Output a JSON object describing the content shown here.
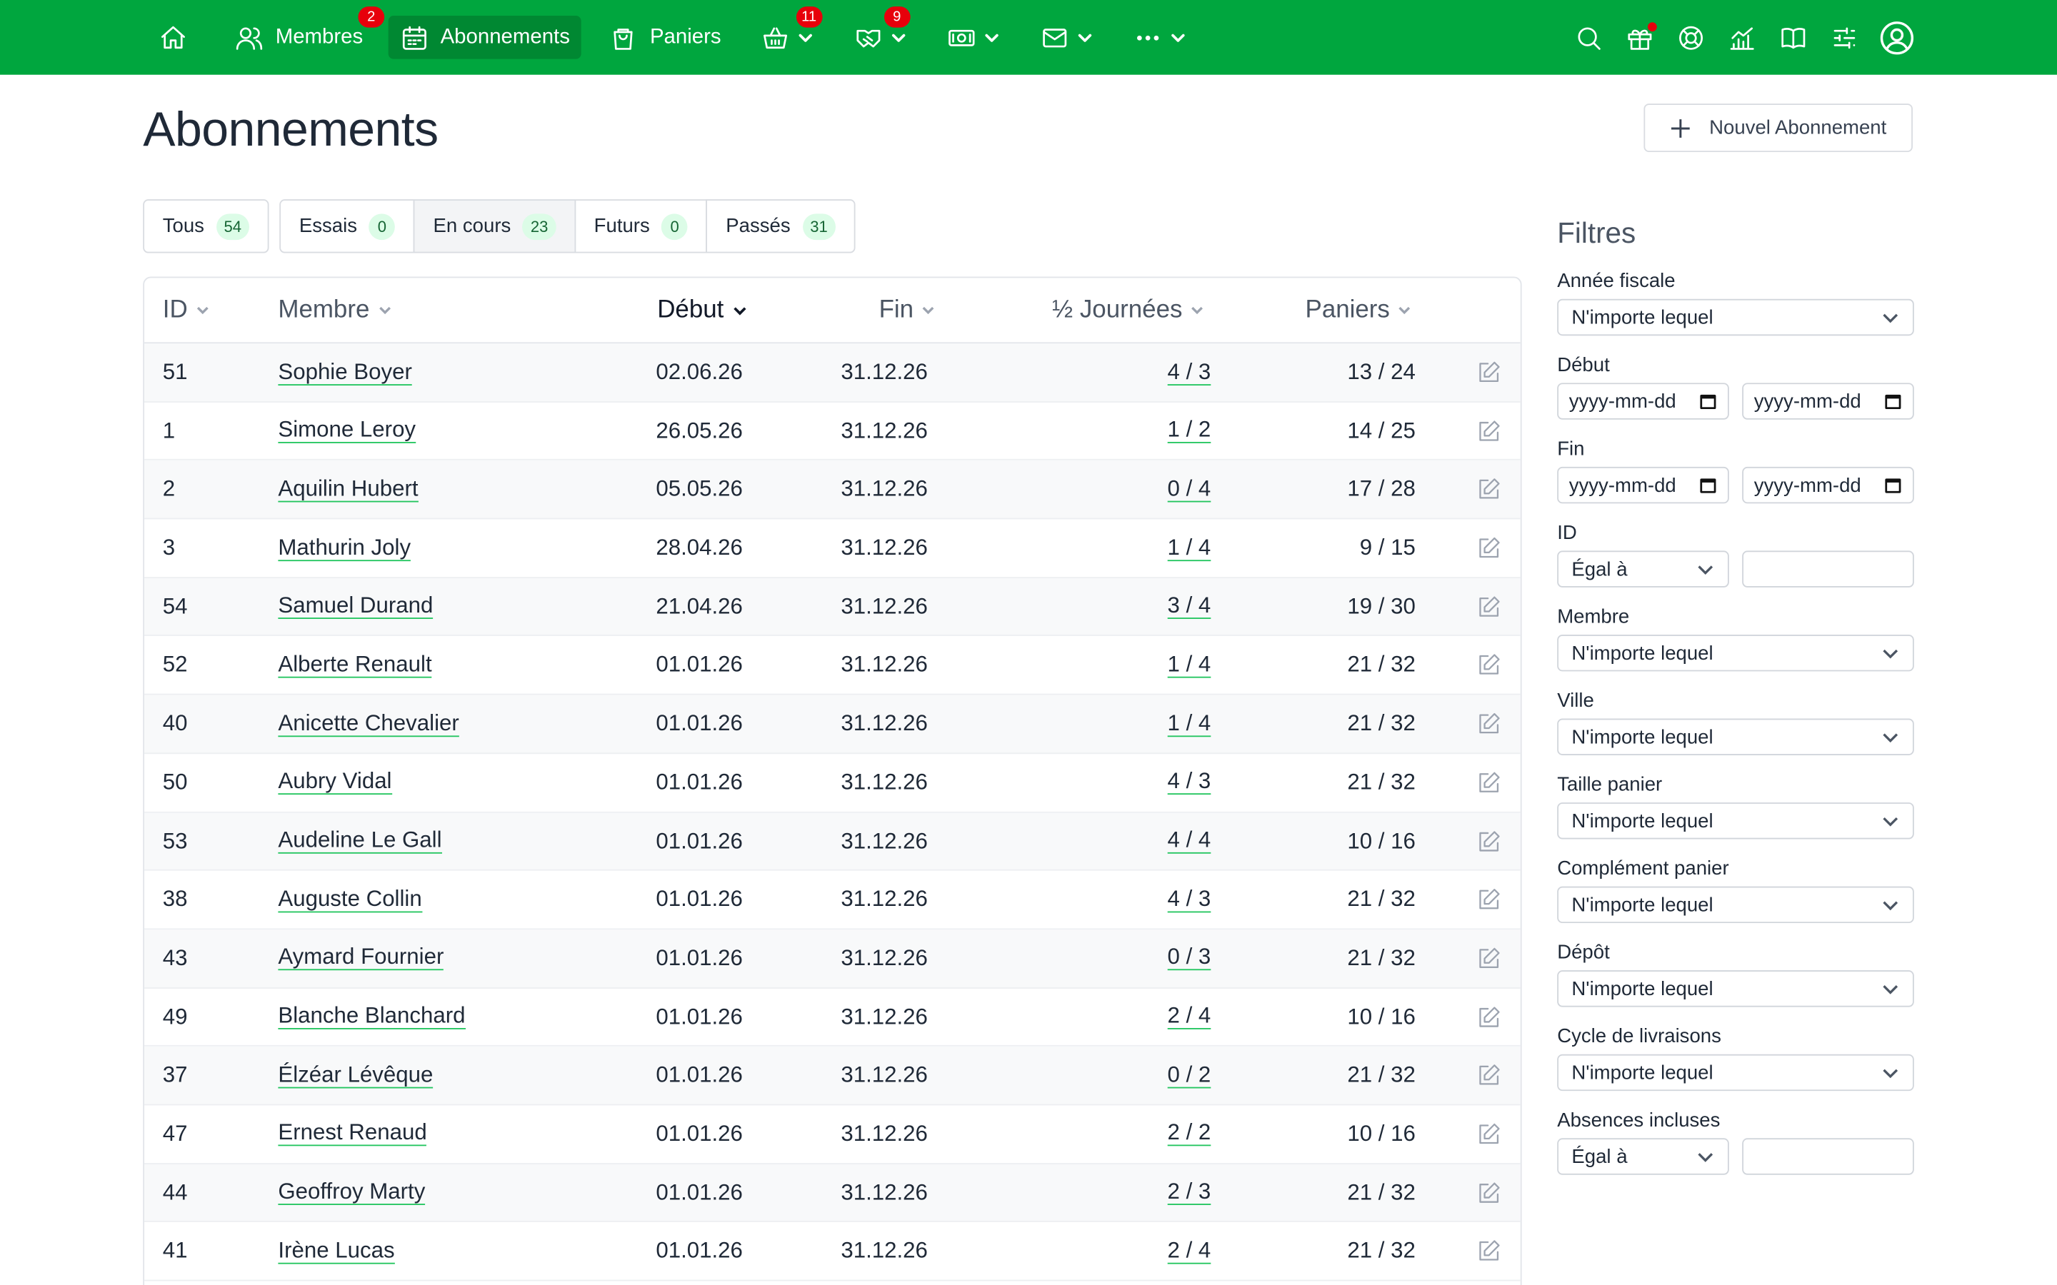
{
  "nav": {
    "items": [
      {
        "label": "",
        "icon": "home-icon"
      },
      {
        "label": "Membres",
        "icon": "users-icon",
        "badge": "2"
      },
      {
        "label": "Abonnements",
        "icon": "calendar-icon",
        "active": true
      },
      {
        "label": "Paniers",
        "icon": "bag-icon"
      },
      {
        "label": "",
        "icon": "basket-icon",
        "badge": "11",
        "dropdown": true
      },
      {
        "label": "",
        "icon": "handshake-icon",
        "badge": "9",
        "dropdown": true
      },
      {
        "label": "",
        "icon": "money-icon",
        "dropdown": true
      },
      {
        "label": "",
        "icon": "mail-icon",
        "dropdown": true
      },
      {
        "label": "",
        "icon": "more-icon",
        "dropdown": true
      }
    ],
    "right_icons": [
      "search-icon",
      "gift-icon",
      "help-icon",
      "stats-icon",
      "book-icon",
      "settings-icon",
      "account-icon"
    ],
    "accent": "#00a63e",
    "badge_color": "#e7000b"
  },
  "page": {
    "title": "Abonnements",
    "new_button": "Nouvel Abonnement"
  },
  "tabs": [
    {
      "label": "Tous",
      "count": "54"
    },
    {
      "label": "Essais",
      "count": "0"
    },
    {
      "label": "En cours",
      "count": "23",
      "active": true
    },
    {
      "label": "Futurs",
      "count": "0"
    },
    {
      "label": "Passés",
      "count": "31"
    }
  ],
  "table": {
    "headers": {
      "id": "ID",
      "membre": "Membre",
      "debut": "Début",
      "fin": "Fin",
      "journees": "½ Journées",
      "paniers": "Paniers"
    },
    "sorted_by": "debut",
    "rows": [
      {
        "id": "51",
        "membre": "Sophie Boyer",
        "debut": "02.06.26",
        "fin": "31.12.26",
        "journees": "4 / 3",
        "paniers": "13 / 24"
      },
      {
        "id": "1",
        "membre": "Simone Leroy",
        "debut": "26.05.26",
        "fin": "31.12.26",
        "journees": "1 / 2",
        "paniers": "14 / 25"
      },
      {
        "id": "2",
        "membre": "Aquilin Hubert",
        "debut": "05.05.26",
        "fin": "31.12.26",
        "journees": "0 / 4",
        "paniers": "17 / 28"
      },
      {
        "id": "3",
        "membre": "Mathurin Joly",
        "debut": "28.04.26",
        "fin": "31.12.26",
        "journees": "1 / 4",
        "paniers": "9 / 15"
      },
      {
        "id": "54",
        "membre": "Samuel Durand",
        "debut": "21.04.26",
        "fin": "31.12.26",
        "journees": "3 / 4",
        "paniers": "19 / 30"
      },
      {
        "id": "52",
        "membre": "Alberte Renault",
        "debut": "01.01.26",
        "fin": "31.12.26",
        "journees": "1 / 4",
        "paniers": "21 / 32"
      },
      {
        "id": "40",
        "membre": "Anicette Chevalier",
        "debut": "01.01.26",
        "fin": "31.12.26",
        "journees": "1 / 4",
        "paniers": "21 / 32"
      },
      {
        "id": "50",
        "membre": "Aubry Vidal",
        "debut": "01.01.26",
        "fin": "31.12.26",
        "journees": "4 / 3",
        "paniers": "21 / 32"
      },
      {
        "id": "53",
        "membre": "Audeline Le Gall",
        "debut": "01.01.26",
        "fin": "31.12.26",
        "journees": "4 / 4",
        "paniers": "10 / 16"
      },
      {
        "id": "38",
        "membre": "Auguste Collin",
        "debut": "01.01.26",
        "fin": "31.12.26",
        "journees": "4 / 3",
        "paniers": "21 / 32"
      },
      {
        "id": "43",
        "membre": "Aymard Fournier",
        "debut": "01.01.26",
        "fin": "31.12.26",
        "journees": "0 / 3",
        "paniers": "21 / 32"
      },
      {
        "id": "49",
        "membre": "Blanche Blanchard",
        "debut": "01.01.26",
        "fin": "31.12.26",
        "journees": "2 / 4",
        "paniers": "10 / 16"
      },
      {
        "id": "37",
        "membre": "Élzéar Lévêque",
        "debut": "01.01.26",
        "fin": "31.12.26",
        "journees": "0 / 2",
        "paniers": "21 / 32"
      },
      {
        "id": "47",
        "membre": "Ernest Renaud",
        "debut": "01.01.26",
        "fin": "31.12.26",
        "journees": "2 / 2",
        "paniers": "10 / 16"
      },
      {
        "id": "44",
        "membre": "Geoffroy Marty",
        "debut": "01.01.26",
        "fin": "31.12.26",
        "journees": "2 / 3",
        "paniers": "21 / 32"
      },
      {
        "id": "41",
        "membre": "Irène Lucas",
        "debut": "01.01.26",
        "fin": "31.12.26",
        "journees": "2 / 4",
        "paniers": "21 / 32"
      }
    ]
  },
  "filters": {
    "title": "Filtres",
    "annee_fiscale": {
      "label": "Année fiscale",
      "value": "N'importe lequel"
    },
    "debut": {
      "label": "Début",
      "from": "yyyy-mm-dd",
      "to": "yyyy-mm-dd"
    },
    "fin": {
      "label": "Fin",
      "from": "yyyy-mm-dd",
      "to": "yyyy-mm-dd"
    },
    "id": {
      "label": "ID",
      "operator": "Égal à",
      "value": ""
    },
    "membre": {
      "label": "Membre",
      "value": "N'importe lequel"
    },
    "ville": {
      "label": "Ville",
      "value": "N'importe lequel"
    },
    "taille_panier": {
      "label": "Taille panier",
      "value": "N'importe lequel"
    },
    "complement_panier": {
      "label": "Complément panier",
      "value": "N'importe lequel"
    },
    "depot": {
      "label": "Dépôt",
      "value": "N'importe lequel"
    },
    "cycle_livraisons": {
      "label": "Cycle de livraisons",
      "value": "N'importe lequel"
    },
    "absences_incluses": {
      "label": "Absences incluses",
      "operator": "Égal à",
      "value": ""
    }
  }
}
